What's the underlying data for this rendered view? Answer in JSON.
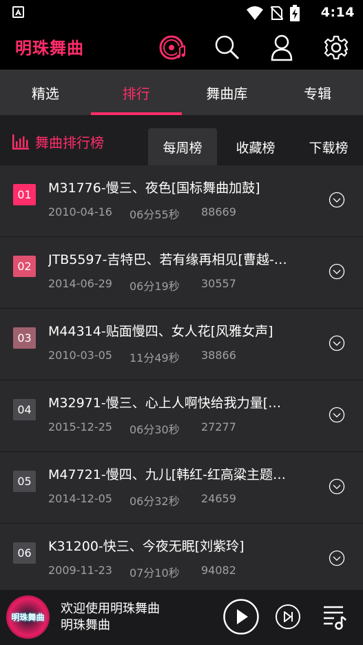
{
  "status_bar": {
    "time": "4:14"
  },
  "app_bar": {
    "title": "明珠舞曲",
    "accent_color": "#ff2d6a"
  },
  "main_tabs": [
    {
      "label": "精选",
      "active": false
    },
    {
      "label": "排行",
      "active": true
    },
    {
      "label": "舞曲库",
      "active": false
    },
    {
      "label": "专辑",
      "active": false
    }
  ],
  "ranking": {
    "label": "舞曲排行榜",
    "tabs": [
      {
        "label": "每周榜",
        "active": true
      },
      {
        "label": "收藏榜",
        "active": false
      },
      {
        "label": "下载榜",
        "active": false
      }
    ]
  },
  "songs": [
    {
      "rank": "01",
      "title": "M31776-慢三、夜色[国标舞曲加鼓]",
      "date": "2010-04-16",
      "length": "06分55秒",
      "plays": "88669",
      "badge_color": "#ff2d6a"
    },
    {
      "rank": "02",
      "title": "JTB5597-吉特巴、若有缘再相见[曹越-…",
      "date": "2014-06-29",
      "length": "06分19秒",
      "plays": "30557",
      "badge_color": "#e0506f"
    },
    {
      "rank": "03",
      "title": "M44314-贴面慢四、女人花[风雅女声]",
      "date": "2010-03-05",
      "length": "11分49秒",
      "plays": "38866",
      "badge_color": "#a0616e"
    },
    {
      "rank": "04",
      "title": "M32971-慢三、心上人啊快给我力量[…",
      "date": "2015-12-25",
      "length": "06分30秒",
      "plays": "27277",
      "badge_color": "#4a4a4e"
    },
    {
      "rank": "05",
      "title": "M47721-慢四、九儿[韩红-红高粱主题…",
      "date": "2014-12-05",
      "length": "06分32秒",
      "plays": "24659",
      "badge_color": "#4a4a4e"
    },
    {
      "rank": "06",
      "title": "K31200-快三、今夜无眠[刘紫玲]",
      "date": "2009-11-23",
      "length": "07分10秒",
      "plays": "94082",
      "badge_color": "#4a4a4e"
    }
  ],
  "player": {
    "line1": "欢迎使用明珠舞曲",
    "line2": "明珠舞曲",
    "art_text": "明珠舞曲"
  }
}
